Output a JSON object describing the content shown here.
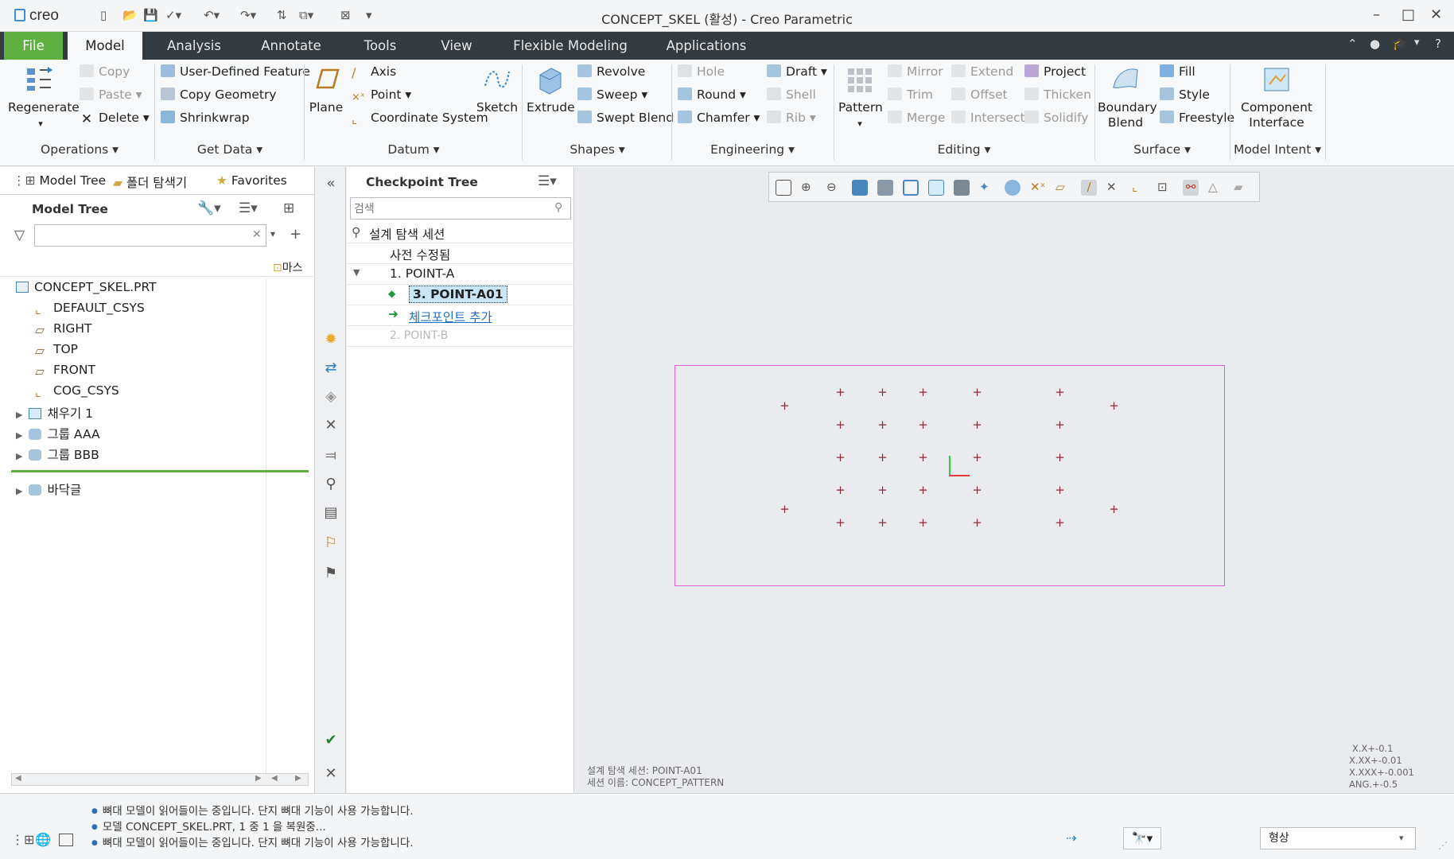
{
  "window": {
    "title": "CONCEPT_SKEL (활성) - Creo Parametric",
    "logo": "creo"
  },
  "menu": {
    "tabs": [
      "File",
      "Model",
      "Analysis",
      "Annotate",
      "Tools",
      "View",
      "Flexible Modeling",
      "Applications"
    ],
    "active": "Model"
  },
  "ribbon": {
    "operations": {
      "regenerate": "Regenerate",
      "copy": "Copy",
      "paste": "Paste",
      "delete": "Delete",
      "group": "Operations"
    },
    "get_data": {
      "udf": "User-Defined Feature",
      "copy_geometry": "Copy Geometry",
      "shrinkwrap": "Shrinkwrap",
      "group": "Get Data"
    },
    "datum": {
      "plane": "Plane",
      "axis": "Axis",
      "point": "Point",
      "csys": "Coordinate System",
      "sketch": "Sketch",
      "group": "Datum"
    },
    "shapes": {
      "extrude": "Extrude",
      "revolve": "Revolve",
      "sweep": "Sweep",
      "swept_blend": "Swept Blend",
      "group": "Shapes"
    },
    "engineering": {
      "hole": "Hole",
      "round": "Round",
      "chamfer": "Chamfer",
      "draft": "Draft",
      "shell": "Shell",
      "rib": "Rib",
      "group": "Engineering"
    },
    "editing": {
      "pattern": "Pattern",
      "mirror": "Mirror",
      "trim": "Trim",
      "merge": "Merge",
      "extend": "Extend",
      "offset": "Offset",
      "intersect": "Intersect",
      "project": "Project",
      "thicken": "Thicken",
      "solidify": "Solidify",
      "group": "Editing"
    },
    "surface": {
      "boundary_blend_1": "Boundary",
      "boundary_blend_2": "Blend",
      "fill": "Fill",
      "style": "Style",
      "freestyle": "Freestyle",
      "group": "Surface"
    },
    "model_intent": {
      "component_interface_1": "Component",
      "component_interface_2": "Interface",
      "group": "Model Intent"
    }
  },
  "left_panel": {
    "tabs": [
      "Model Tree",
      "폴더 탐색기",
      "Favorites"
    ],
    "header": "Model Tree",
    "filter_placeholder": "",
    "column_label": "마스",
    "items": [
      {
        "label": "CONCEPT_SKEL.PRT",
        "icon": "part-icon"
      },
      {
        "label": "DEFAULT_CSYS",
        "icon": "csys-icon"
      },
      {
        "label": "RIGHT",
        "icon": "datum-plane-icon"
      },
      {
        "label": "TOP",
        "icon": "datum-plane-icon"
      },
      {
        "label": "FRONT",
        "icon": "datum-plane-icon"
      },
      {
        "label": "COG_CSYS",
        "icon": "csys-icon"
      },
      {
        "label": "채우기 1",
        "icon": "fill-icon"
      },
      {
        "label": "그룹 AAA",
        "icon": "group-icon"
      },
      {
        "label": "그룹 BBB",
        "icon": "group-icon"
      },
      {
        "label": "바닥글",
        "icon": "group-icon"
      }
    ]
  },
  "checkpoint_tree": {
    "header": "Checkpoint Tree",
    "search_placeholder": "검색",
    "session": "설계 탐색 세션",
    "pre_modified": "사전 수정됨",
    "point_a": "1. POINT-A",
    "point_a01": "3. POINT-A01",
    "add_checkpoint": "체크포인트 추가",
    "point_b": "2. POINT-B"
  },
  "graphics": {
    "session_info_1": "설계 탐색 세션: POINT-A01",
    "session_info_2": "세션 이름: CONCEPT_PATTERN",
    "tolerances": [
      "X.X+-0.1",
      "X.XX+-0.01",
      "X.XXX+-0.001",
      "ANG.+-0.5"
    ],
    "sketch_border_color": "#e05fd4",
    "point_color": "#8b2b3a"
  },
  "status": {
    "messages": [
      "뼈대 모델이 읽어들이는 중입니다. 단지 뼈대 기능이 사용 가능합니다.",
      "모델 CONCEPT_SKEL.PRT, 1 중 1 을 복원중...",
      "뼈대 모델이 읽어들이는 중입니다. 단지 뼈대 기능이 사용 가능합니다."
    ],
    "filter_value": "형상"
  }
}
